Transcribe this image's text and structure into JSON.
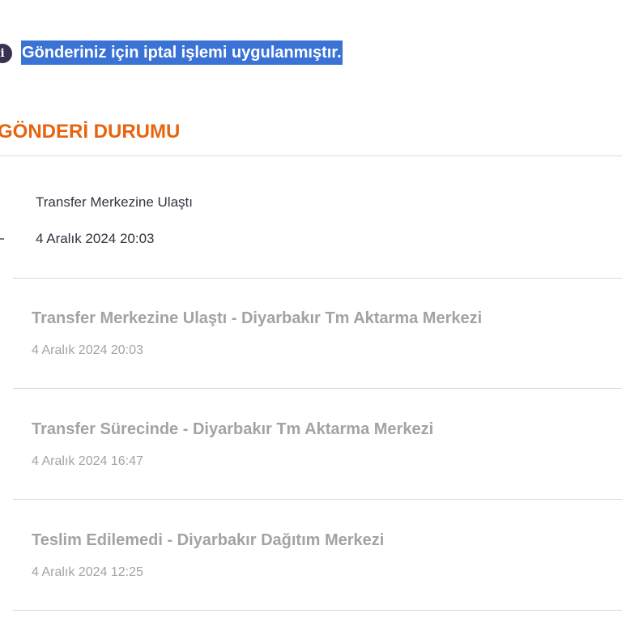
{
  "notice": {
    "icon": "info-icon",
    "icon_glyph": "i",
    "text": "Gönderiniz için iptal işlemi uygulanmıştır."
  },
  "status": {
    "heading": "GÖNDERİ DURUMU",
    "current": {
      "title": "Transfer Merkezine Ulaştı",
      "date": "4 Aralık 2024 20:03"
    },
    "history": [
      {
        "title": "Transfer Merkezine Ulaştı - Diyarbakır Tm Aktarma Merkezi",
        "date": "4 Aralık 2024 20:03"
      },
      {
        "title": "Transfer Sürecinde - Diyarbakır Tm Aktarma Merkezi",
        "date": "4 Aralık 2024 16:47"
      },
      {
        "title": "Teslim Edilemedi - Diyarbakır Dağıtım Merkezi",
        "date": "4 Aralık 2024 12:25"
      }
    ]
  },
  "colors": {
    "heading": "#e8630f",
    "selection": "#3a73d5",
    "icon": "#3a3150",
    "current_text": "#333340",
    "history_text": "#a3a3a3",
    "divider": "#d9d9d9"
  }
}
